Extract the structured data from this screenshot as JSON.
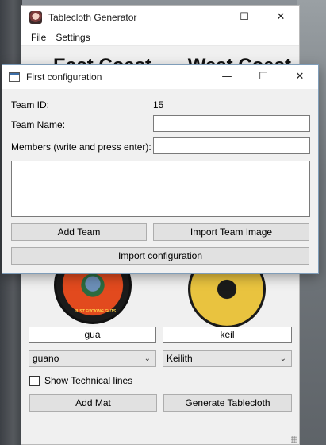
{
  "main_window": {
    "title": "Tablecloth Generator",
    "controls": {
      "minimize": "—",
      "maximize": "☐",
      "close": "✕"
    },
    "menu": [
      {
        "label": "File"
      },
      {
        "label": "Settings"
      }
    ],
    "heading_left": "East Coast",
    "heading_right": "West Coast",
    "team_left": {
      "name": "gua",
      "player": "guano",
      "logo_text": "JUST FUCKING GUTS"
    },
    "team_right": {
      "name": "keil",
      "player": "Keilith"
    },
    "show_technical_lines_label": "Show Technical lines",
    "show_technical_lines_checked": false,
    "add_mat_label": "Add Mat",
    "generate_label": "Generate Tablecloth"
  },
  "dialog": {
    "title": "First configuration",
    "controls": {
      "minimize": "—",
      "maximize": "☐",
      "close": "✕"
    },
    "team_id_label": "Team ID:",
    "team_id_value": "15",
    "team_name_label": "Team Name:",
    "team_name_value": "",
    "members_label": "Members (write and press enter):",
    "members_value": "",
    "add_team_label": "Add Team",
    "import_team_image_label": "Import Team Image",
    "import_configuration_label": "Import configuration"
  }
}
